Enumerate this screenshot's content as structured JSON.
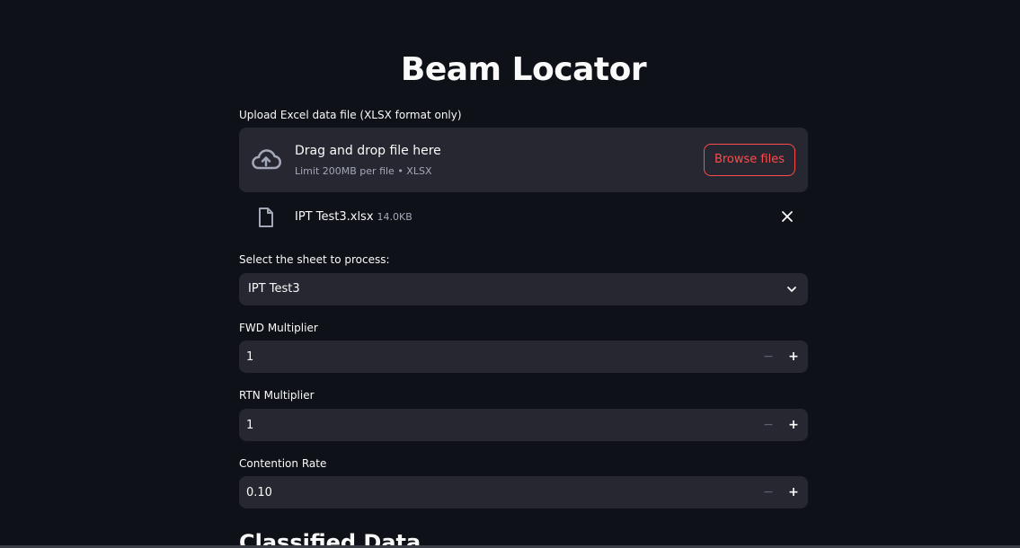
{
  "app": {
    "title": "Beam Locator"
  },
  "upload": {
    "label": "Upload Excel data file (XLSX format only)",
    "drop_text": "Drag and drop file here",
    "limit_text": "Limit 200MB per file • XLSX",
    "browse_label": "Browse files",
    "file_name": "IPT Test3.xlsx",
    "file_size": "14.0KB"
  },
  "sheet_select": {
    "label": "Select the sheet to process:",
    "value": "IPT Test3"
  },
  "fwd_multiplier": {
    "label": "FWD Multiplier",
    "value": "1",
    "minus": "−",
    "plus": "+"
  },
  "rtn_multiplier": {
    "label": "RTN Multiplier",
    "value": "1",
    "minus": "−",
    "plus": "+"
  },
  "contention_rate": {
    "label": "Contention Rate",
    "value": "0.10",
    "minus": "−",
    "plus": "+"
  },
  "section": {
    "heading": "Classified Data"
  },
  "icons": {
    "upload": "cloud-upload-icon",
    "file": "file-icon",
    "close": "close-icon",
    "chevron": "chevron-down-icon"
  },
  "colors": {
    "background": "#0e1117",
    "widget": "#262730",
    "accent": "#ff4b4b",
    "muted_text": "#a3a8b8"
  }
}
